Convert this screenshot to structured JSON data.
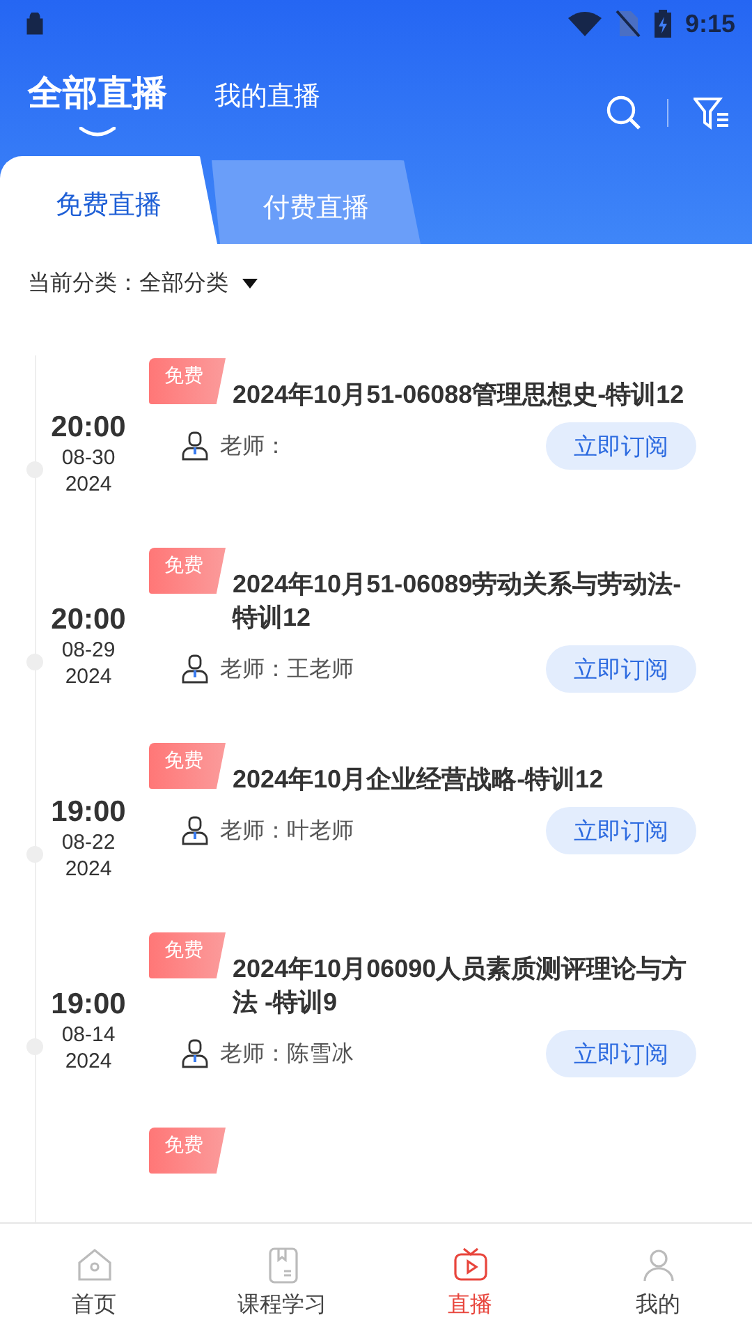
{
  "status_bar": {
    "time": "9:15"
  },
  "header_tabs": [
    {
      "label": "全部直播",
      "selected": true
    },
    {
      "label": "我的直播",
      "selected": false
    }
  ],
  "sub_tabs": [
    {
      "label": "免费直播",
      "selected": true
    },
    {
      "label": "付费直播",
      "selected": false
    }
  ],
  "category": {
    "label": "当前分类：",
    "value": "全部分类"
  },
  "lives": [
    {
      "time": "20:00",
      "date": "08-30",
      "year": "2024",
      "tag": "免费",
      "title": "2024年10月51-06088管理思想史-特训12",
      "teacher": "老师：",
      "button": "立即订阅"
    },
    {
      "time": "20:00",
      "date": "08-29",
      "year": "2024",
      "tag": "免费",
      "title": "2024年10月51-06089劳动关系与劳动法-特训12",
      "teacher": "老师：王老师",
      "button": "立即订阅"
    },
    {
      "time": "19:00",
      "date": "08-22",
      "year": "2024",
      "tag": "免费",
      "title": "2024年10月企业经营战略-特训12",
      "teacher": "老师：叶老师",
      "button": "立即订阅"
    },
    {
      "time": "19:00",
      "date": "08-14",
      "year": "2024",
      "tag": "免费",
      "title": "2024年10月06090人员素质测评理论与方法 -特训9",
      "teacher": "老师：陈雪冰",
      "button": "立即订阅"
    }
  ],
  "partial_item": {
    "tag": "免费"
  },
  "bottom_nav": [
    {
      "kind": "home",
      "label": "首页",
      "selected": false
    },
    {
      "kind": "course",
      "label": "课程学习",
      "selected": false
    },
    {
      "kind": "live",
      "label": "直播",
      "selected": true
    },
    {
      "kind": "mine",
      "label": "我的",
      "selected": false
    }
  ]
}
